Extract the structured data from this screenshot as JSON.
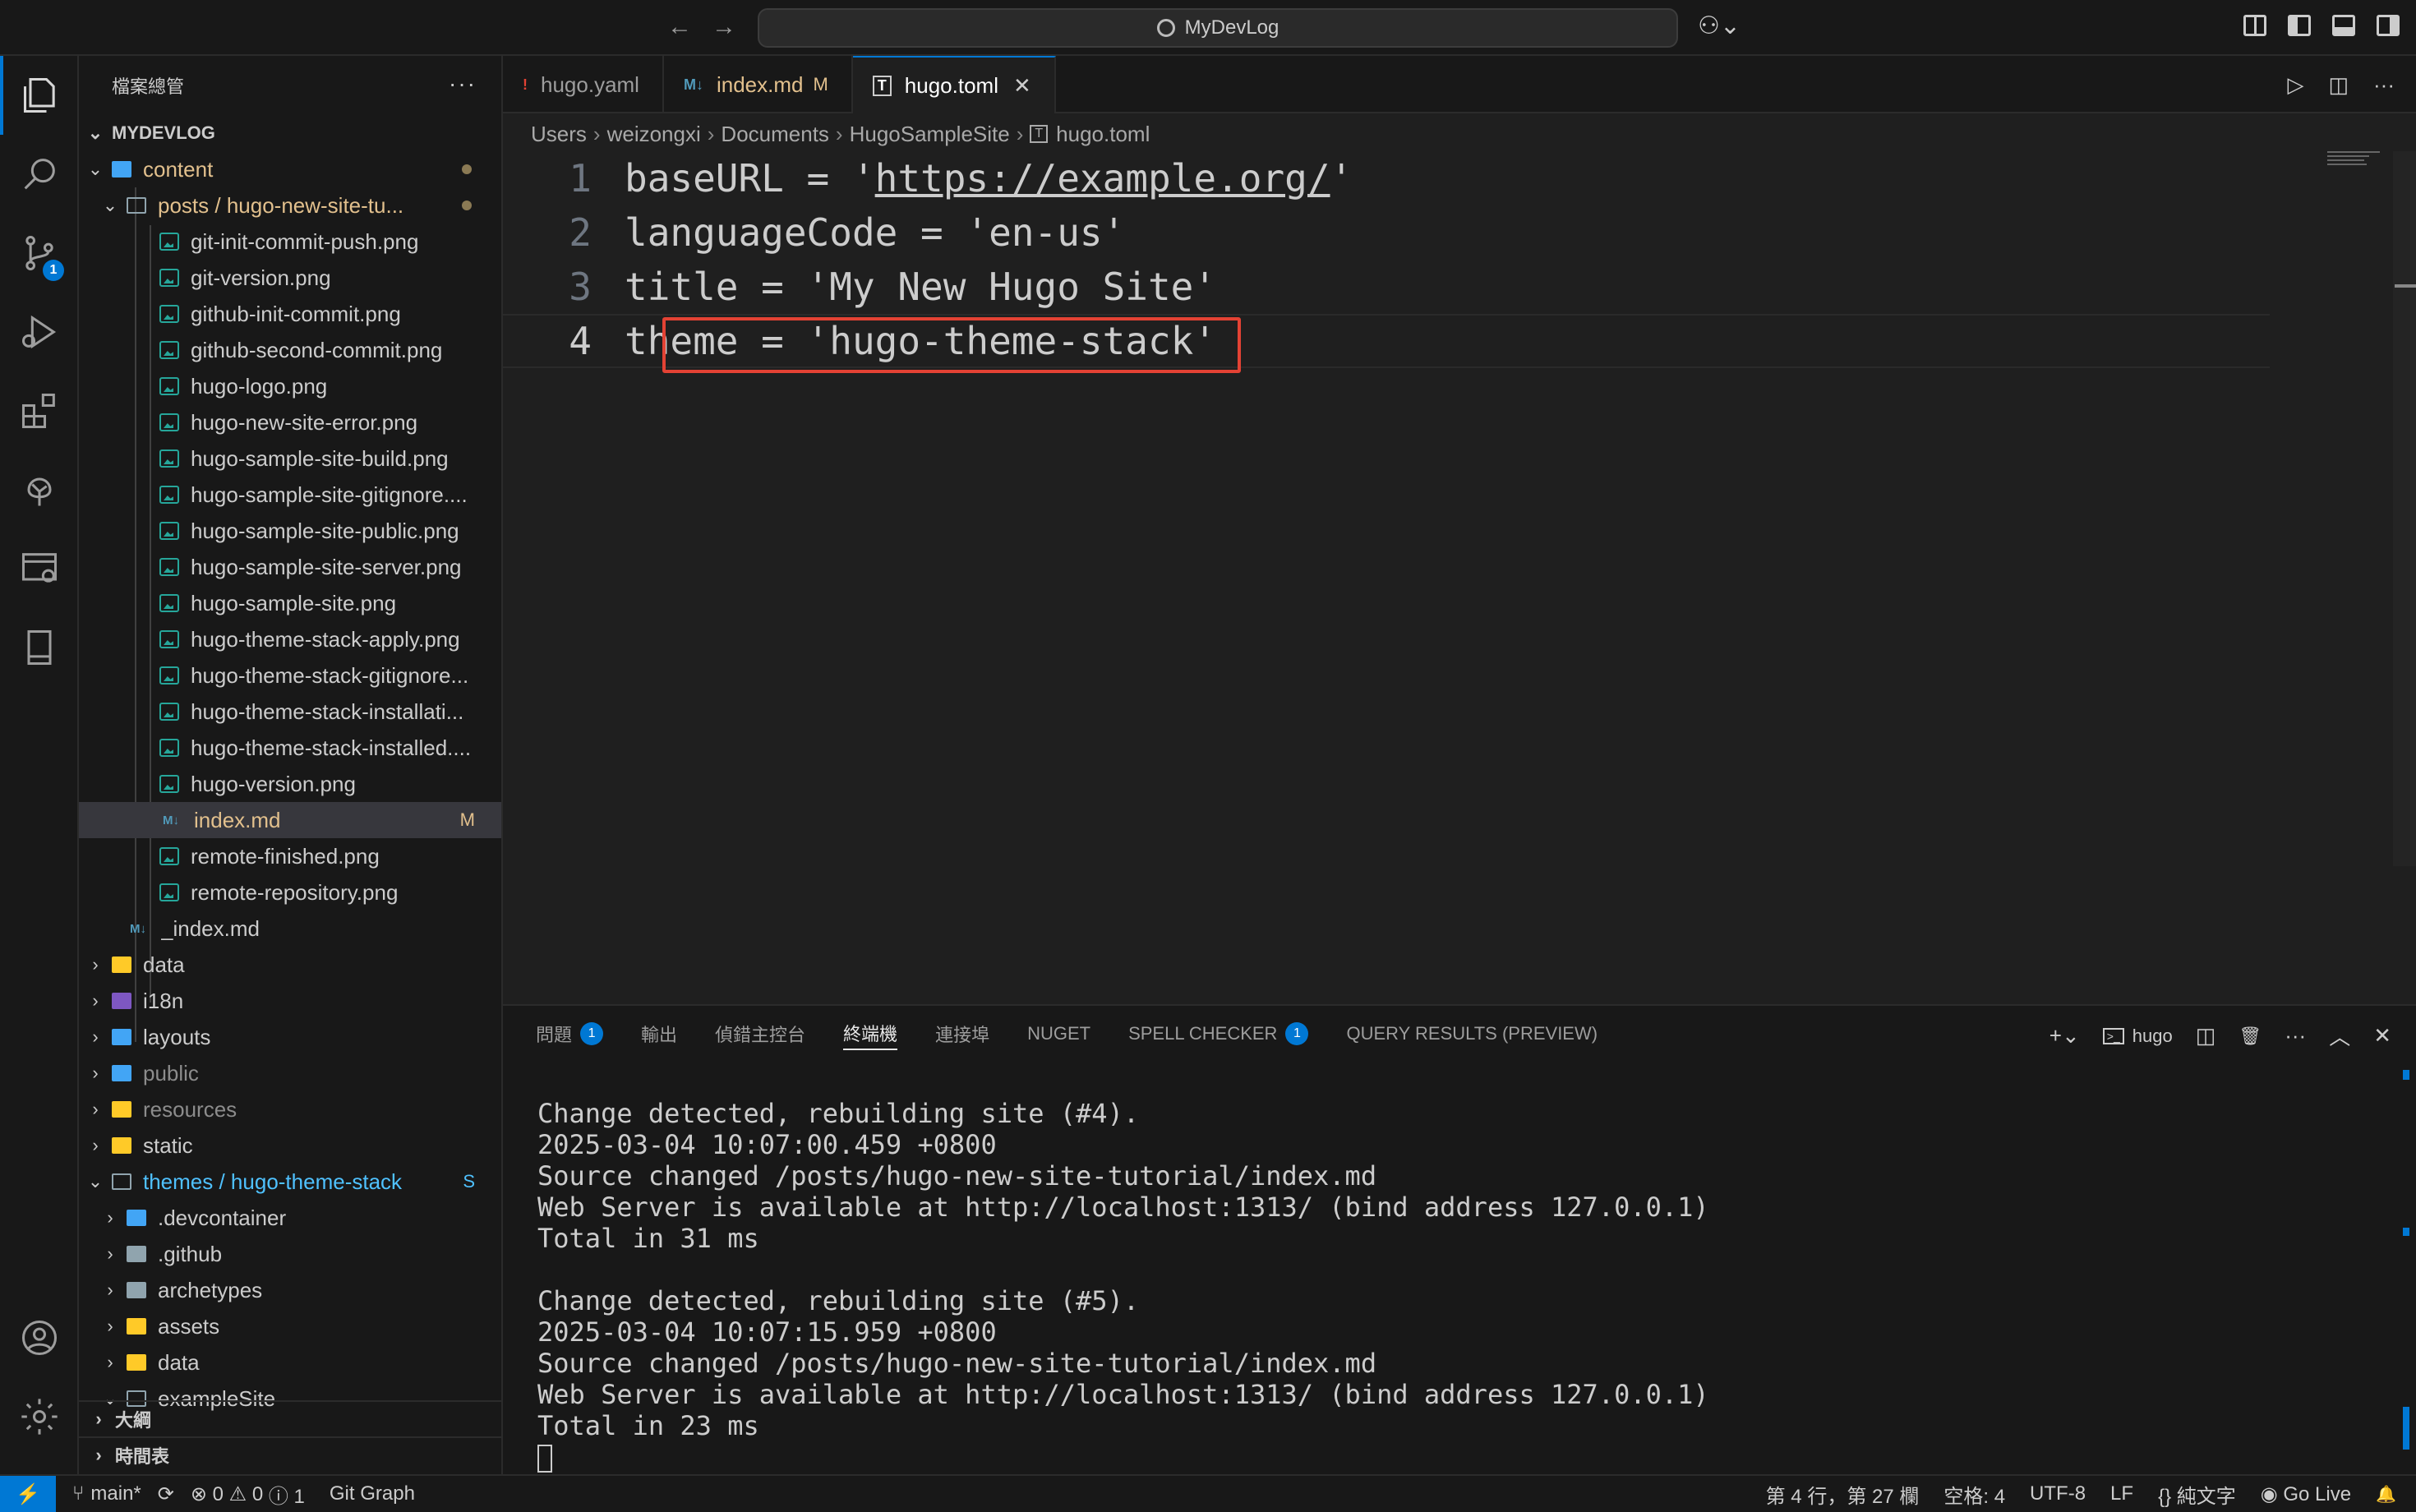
{
  "titlebar": {
    "search_text": "MyDevLog",
    "back": "←",
    "forward": "→",
    "copilot": "⚇⌄"
  },
  "activity": {
    "scm_badge": "1"
  },
  "sidebar": {
    "title": "檔案總管",
    "more": "···",
    "root": "MYDEVLOG",
    "sections": {
      "outline": "大綱",
      "timeline": "時間表"
    }
  },
  "tree": [
    {
      "label": "content",
      "depth": 1,
      "kind": "folder-blue",
      "chevron": "⌄",
      "status": "dot"
    },
    {
      "label": "posts / hugo-new-site-tu...",
      "depth": 2,
      "kind": "folder-open",
      "chevron": "⌄",
      "status": "dot"
    },
    {
      "label": "git-init-commit-push.png",
      "depth": 3,
      "kind": "img"
    },
    {
      "label": "git-version.png",
      "depth": 3,
      "kind": "img"
    },
    {
      "label": "github-init-commit.png",
      "depth": 3,
      "kind": "img"
    },
    {
      "label": "github-second-commit.png",
      "depth": 3,
      "kind": "img"
    },
    {
      "label": "hugo-logo.png",
      "depth": 3,
      "kind": "img"
    },
    {
      "label": "hugo-new-site-error.png",
      "depth": 3,
      "kind": "img"
    },
    {
      "label": "hugo-sample-site-build.png",
      "depth": 3,
      "kind": "img"
    },
    {
      "label": "hugo-sample-site-gitignore....",
      "depth": 3,
      "kind": "img"
    },
    {
      "label": "hugo-sample-site-public.png",
      "depth": 3,
      "kind": "img"
    },
    {
      "label": "hugo-sample-site-server.png",
      "depth": 3,
      "kind": "img"
    },
    {
      "label": "hugo-sample-site.png",
      "depth": 3,
      "kind": "img"
    },
    {
      "label": "hugo-theme-stack-apply.png",
      "depth": 3,
      "kind": "img"
    },
    {
      "label": "hugo-theme-stack-gitignore...",
      "depth": 3,
      "kind": "img"
    },
    {
      "label": "hugo-theme-stack-installati...",
      "depth": 3,
      "kind": "img"
    },
    {
      "label": "hugo-theme-stack-installed....",
      "depth": 3,
      "kind": "img"
    },
    {
      "label": "hugo-version.png",
      "depth": 3,
      "kind": "img"
    },
    {
      "label": "index.md",
      "depth": 3,
      "kind": "md",
      "status": "M",
      "selected": true
    },
    {
      "label": "remote-finished.png",
      "depth": 3,
      "kind": "img"
    },
    {
      "label": "remote-repository.png",
      "depth": 3,
      "kind": "img"
    },
    {
      "label": "_index.md",
      "depth": 2,
      "kind": "md"
    },
    {
      "label": "data",
      "depth": 1,
      "kind": "folder-yellow",
      "chevron": "›"
    },
    {
      "label": "i18n",
      "depth": 1,
      "kind": "folder-purple",
      "chevron": "›"
    },
    {
      "label": "layouts",
      "depth": 1,
      "kind": "folder-blue",
      "chevron": "›"
    },
    {
      "label": "public",
      "depth": 1,
      "kind": "folder-blue",
      "chevron": "›",
      "dim": true
    },
    {
      "label": "resources",
      "depth": 1,
      "kind": "folder-yellow",
      "chevron": "›",
      "dim": true
    },
    {
      "label": "static",
      "depth": 1,
      "kind": "folder-yellow",
      "chevron": "›"
    },
    {
      "label": "themes / hugo-theme-stack",
      "depth": 1,
      "kind": "folder-open",
      "chevron": "⌄",
      "status": "S",
      "blue": true
    },
    {
      "label": ".devcontainer",
      "depth": 2,
      "kind": "folder-blue",
      "chevron": "›"
    },
    {
      "label": ".github",
      "depth": 2,
      "kind": "folder-gray",
      "chevron": "›"
    },
    {
      "label": "archetypes",
      "depth": 2,
      "kind": "folder-gray",
      "chevron": "›"
    },
    {
      "label": "assets",
      "depth": 2,
      "kind": "folder-yellow",
      "chevron": "›"
    },
    {
      "label": "data",
      "depth": 2,
      "kind": "folder-yellow",
      "chevron": "›"
    },
    {
      "label": "exampleSite",
      "depth": 2,
      "kind": "folder-open",
      "chevron": "⌄"
    }
  ],
  "tabs": [
    {
      "label": "hugo.yaml",
      "icon": "!",
      "icon_color": "#e34234",
      "active": false
    },
    {
      "label": "index.md",
      "icon": "M↓",
      "icon_color": "#519aba",
      "active": false,
      "modified": "M"
    },
    {
      "label": "hugo.toml",
      "icon": "T",
      "icon_color": "#cccccc",
      "active": true,
      "close": "✕"
    }
  ],
  "tab_actions": [
    "▷",
    "◫",
    "···"
  ],
  "breadcrumb": [
    "Users",
    "weizongxi",
    "Documents",
    "HugoSampleSite",
    "hugo.toml"
  ],
  "editor": {
    "lines": [
      {
        "num": "1",
        "pre": "baseURL = '",
        "url": "https://example.org/",
        "post": "'"
      },
      {
        "num": "2",
        "pre": "languageCode = 'en-us'",
        "url": "",
        "post": ""
      },
      {
        "num": "3",
        "pre": "title = 'My New Hugo Site'",
        "url": "",
        "post": ""
      },
      {
        "num": "4",
        "pre": "theme = 'hugo-theme-stack'",
        "url": "",
        "post": ""
      }
    ],
    "highlight_color": "#e34234"
  },
  "panel": {
    "tabs": [
      {
        "label": "問題",
        "badge": "1"
      },
      {
        "label": "輸出"
      },
      {
        "label": "偵錯主控台"
      },
      {
        "label": "終端機",
        "active": true
      },
      {
        "label": "連接埠"
      },
      {
        "label": "NUGET"
      },
      {
        "label": "SPELL CHECKER",
        "badge": "1"
      },
      {
        "label": "QUERY RESULTS (PREVIEW)"
      }
    ],
    "terminal_name": "hugo",
    "actions": {
      "add": "+⌄",
      "split": "◫",
      "trash": "🗑",
      "more": "···",
      "max": "︿",
      "close": "✕"
    },
    "terminal_lines": [
      "Change detected, rebuilding site (#4).",
      "2025-03-04 10:07:00.459 +0800",
      "Source changed /posts/hugo-new-site-tutorial/index.md",
      "Web Server is available at http://localhost:1313/ (bind address 127.0.0.1)",
      "Total in 31 ms",
      "",
      "Change detected, rebuilding site (#5).",
      "2025-03-04 10:07:15.959 +0800",
      "Source changed /posts/hugo-new-site-tutorial/index.md",
      "Web Server is available at http://localhost:1313/ (bind address 127.0.0.1)",
      "Total in 23 ms"
    ]
  },
  "statusbar": {
    "remote": "⚡",
    "branch": "main*",
    "sync": "⟳",
    "errors": "⊗ 0",
    "warnings": "⚠ 0",
    "info": "ⓘ 1",
    "git_graph": "Git Graph",
    "position": "第 4 行，第 27 欄",
    "spaces": "空格: 4",
    "encoding": "UTF-8",
    "eol": "LF",
    "language": "{} 純文字",
    "golive": "Go Live",
    "bell": "🔔"
  },
  "colors": {
    "accent": "#0078d4",
    "modified": "#e2c08d",
    "image_icon": "#26a69a",
    "themes_folder": "#4fc1ff"
  }
}
